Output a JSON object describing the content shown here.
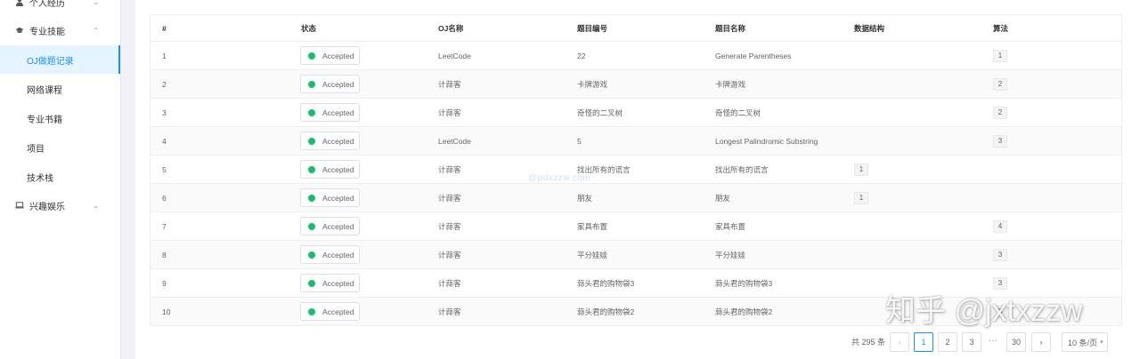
{
  "sidebar": {
    "top_cut_label": "个人经历",
    "group_skills": "专业技能",
    "items": [
      {
        "label": "OJ做题记录",
        "active": true
      },
      {
        "label": "网络课程"
      },
      {
        "label": "专业书籍"
      },
      {
        "label": "项目"
      },
      {
        "label": "技术栈"
      }
    ],
    "group_hobby": "兴趣娱乐"
  },
  "table": {
    "columns": [
      "#",
      "状态",
      "OJ名称",
      "题目编号",
      "题目名称",
      "数据结构",
      "算法"
    ],
    "rows": [
      {
        "index": "1",
        "status": "Accepted",
        "oj": "LeetCode",
        "pid": "22",
        "name": "Generate Parentheses",
        "ds": "",
        "algo": "1"
      },
      {
        "index": "2",
        "status": "Accepted",
        "oj": "计蒜客",
        "pid": "卡牌游戏",
        "name": "卡牌游戏",
        "ds": "",
        "algo": "2"
      },
      {
        "index": "3",
        "status": "Accepted",
        "oj": "计蒜客",
        "pid": "奇怪的二叉树",
        "name": "奇怪的二叉树",
        "ds": "",
        "algo": "2"
      },
      {
        "index": "4",
        "status": "Accepted",
        "oj": "LeetCode",
        "pid": "5",
        "name": "Longest Palindromic Substring",
        "ds": "",
        "algo": "3"
      },
      {
        "index": "5",
        "status": "Accepted",
        "oj": "计蒜客",
        "pid": "找出所有的谎言",
        "name": "找出所有的谎言",
        "ds": "1",
        "algo": ""
      },
      {
        "index": "6",
        "status": "Accepted",
        "oj": "计蒜客",
        "pid": "朋友",
        "name": "朋友",
        "ds": "1",
        "algo": ""
      },
      {
        "index": "7",
        "status": "Accepted",
        "oj": "计蒜客",
        "pid": "家具布置",
        "name": "家具布置",
        "ds": "",
        "algo": "4"
      },
      {
        "index": "8",
        "status": "Accepted",
        "oj": "计蒜客",
        "pid": "平分娃娃",
        "name": "平分娃娃",
        "ds": "",
        "algo": "3"
      },
      {
        "index": "9",
        "status": "Accepted",
        "oj": "计蒜客",
        "pid": "蒜头君的购物袋3",
        "name": "蒜头君的购物袋3",
        "ds": "",
        "algo": "3"
      },
      {
        "index": "10",
        "status": "Accepted",
        "oj": "计蒜客",
        "pid": "蒜头君的购物袋2",
        "name": "蒜头君的购物袋2",
        "ds": "",
        "algo": "3"
      }
    ]
  },
  "pagination": {
    "total": "共 295 条",
    "prev": "‹",
    "pages": [
      "1",
      "2",
      "3"
    ],
    "ellipsis": "···",
    "last": "30",
    "next": "›",
    "page_size": "10 条/页"
  },
  "watermark": {
    "center": "@pdxzzw.com",
    "brand": "知乎 @jxtxzzw"
  },
  "colors": {
    "accent": "#1890ff",
    "success_dot": "#19be6b"
  },
  "icons": {
    "user": "user-icon",
    "skills": "graduation-cap-icon",
    "hobby": "laptop-icon"
  }
}
